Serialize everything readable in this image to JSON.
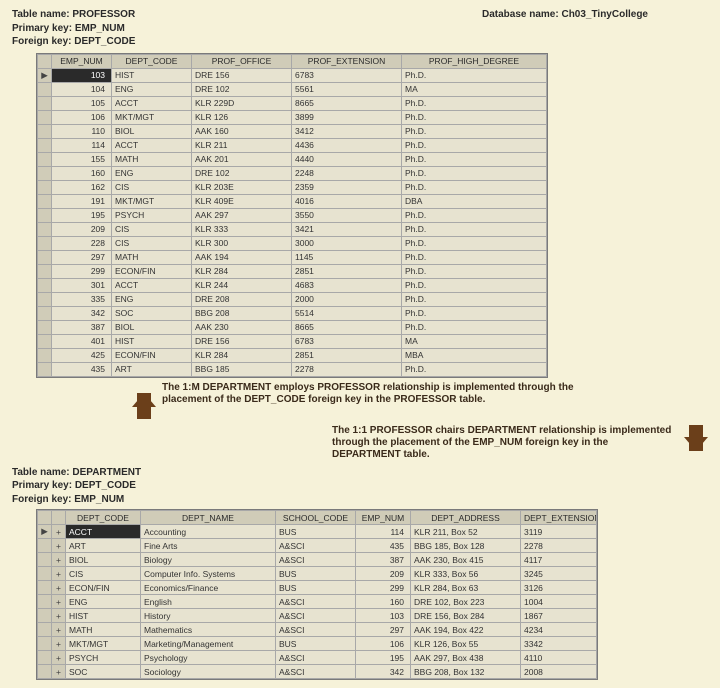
{
  "meta": {
    "table1_name_label": "Table name: PROFESSOR",
    "table1_pk_label": "Primary key: EMP_NUM",
    "table1_fk_label": "Foreign key: DEPT_CODE",
    "db_name_label": "Database name: Ch03_TinyCollege",
    "table2_name_label": "Table name: DEPARTMENT",
    "table2_pk_label": "Primary key: DEPT_CODE",
    "table2_fk_label": "Foreign key: EMP_NUM"
  },
  "prof_cols": [
    "EMP_NUM",
    "DEPT_CODE",
    "PROF_OFFICE",
    "PROF_EXTENSION",
    "PROF_HIGH_DEGREE"
  ],
  "prof_rows": [
    {
      "emp": "103",
      "dept": "HIST",
      "office": "DRE 156",
      "ext": "6783",
      "deg": "Ph.D.",
      "sel": true,
      "marker": "▶"
    },
    {
      "emp": "104",
      "dept": "ENG",
      "office": "DRE 102",
      "ext": "5561",
      "deg": "MA"
    },
    {
      "emp": "105",
      "dept": "ACCT",
      "office": "KLR 229D",
      "ext": "8665",
      "deg": "Ph.D."
    },
    {
      "emp": "106",
      "dept": "MKT/MGT",
      "office": "KLR 126",
      "ext": "3899",
      "deg": "Ph.D."
    },
    {
      "emp": "110",
      "dept": "BIOL",
      "office": "AAK 160",
      "ext": "3412",
      "deg": "Ph.D."
    },
    {
      "emp": "114",
      "dept": "ACCT",
      "office": "KLR 211",
      "ext": "4436",
      "deg": "Ph.D."
    },
    {
      "emp": "155",
      "dept": "MATH",
      "office": "AAK 201",
      "ext": "4440",
      "deg": "Ph.D."
    },
    {
      "emp": "160",
      "dept": "ENG",
      "office": "DRE 102",
      "ext": "2248",
      "deg": "Ph.D."
    },
    {
      "emp": "162",
      "dept": "CIS",
      "office": "KLR 203E",
      "ext": "2359",
      "deg": "Ph.D."
    },
    {
      "emp": "191",
      "dept": "MKT/MGT",
      "office": "KLR 409E",
      "ext": "4016",
      "deg": "DBA"
    },
    {
      "emp": "195",
      "dept": "PSYCH",
      "office": "AAK 297",
      "ext": "3550",
      "deg": "Ph.D."
    },
    {
      "emp": "209",
      "dept": "CIS",
      "office": "KLR 333",
      "ext": "3421",
      "deg": "Ph.D."
    },
    {
      "emp": "228",
      "dept": "CIS",
      "office": "KLR 300",
      "ext": "3000",
      "deg": "Ph.D."
    },
    {
      "emp": "297",
      "dept": "MATH",
      "office": "AAK 194",
      "ext": "1145",
      "deg": "Ph.D."
    },
    {
      "emp": "299",
      "dept": "ECON/FIN",
      "office": "KLR 284",
      "ext": "2851",
      "deg": "Ph.D."
    },
    {
      "emp": "301",
      "dept": "ACCT",
      "office": "KLR 244",
      "ext": "4683",
      "deg": "Ph.D."
    },
    {
      "emp": "335",
      "dept": "ENG",
      "office": "DRE 208",
      "ext": "2000",
      "deg": "Ph.D."
    },
    {
      "emp": "342",
      "dept": "SOC",
      "office": "BBG 208",
      "ext": "5514",
      "deg": "Ph.D."
    },
    {
      "emp": "387",
      "dept": "BIOL",
      "office": "AAK 230",
      "ext": "8665",
      "deg": "Ph.D."
    },
    {
      "emp": "401",
      "dept": "HIST",
      "office": "DRE 156",
      "ext": "6783",
      "deg": "MA"
    },
    {
      "emp": "425",
      "dept": "ECON/FIN",
      "office": "KLR 284",
      "ext": "2851",
      "deg": "MBA"
    },
    {
      "emp": "435",
      "dept": "ART",
      "office": "BBG 185",
      "ext": "2278",
      "deg": "Ph.D."
    }
  ],
  "dept_cols": [
    "DEPT_CODE",
    "DEPT_NAME",
    "SCHOOL_CODE",
    "EMP_NUM",
    "DEPT_ADDRESS",
    "DEPT_EXTENSION"
  ],
  "dept_rows": [
    {
      "marker": "▶",
      "code": "ACCT",
      "name": "Accounting",
      "school": "BUS",
      "emp": "114",
      "addr": "KLR 211, Box 52",
      "ext": "3119",
      "sel": true
    },
    {
      "marker": "+",
      "code": "ART",
      "name": "Fine Arts",
      "school": "A&SCI",
      "emp": "435",
      "addr": "BBG 185, Box 128",
      "ext": "2278"
    },
    {
      "marker": "+",
      "code": "BIOL",
      "name": "Biology",
      "school": "A&SCI",
      "emp": "387",
      "addr": "AAK 230, Box 415",
      "ext": "4117"
    },
    {
      "marker": "+",
      "code": "CIS",
      "name": "Computer Info. Systems",
      "school": "BUS",
      "emp": "209",
      "addr": "KLR 333, Box 56",
      "ext": "3245"
    },
    {
      "marker": "+",
      "code": "ECON/FIN",
      "name": "Economics/Finance",
      "school": "BUS",
      "emp": "299",
      "addr": "KLR 284, Box 63",
      "ext": "3126"
    },
    {
      "marker": "+",
      "code": "ENG",
      "name": "English",
      "school": "A&SCI",
      "emp": "160",
      "addr": "DRE 102, Box 223",
      "ext": "1004"
    },
    {
      "marker": "+",
      "code": "HIST",
      "name": "History",
      "school": "A&SCI",
      "emp": "103",
      "addr": "DRE 156, Box 284",
      "ext": "1867"
    },
    {
      "marker": "+",
      "code": "MATH",
      "name": "Mathematics",
      "school": "A&SCI",
      "emp": "297",
      "addr": "AAK 194, Box 422",
      "ext": "4234"
    },
    {
      "marker": "+",
      "code": "MKT/MGT",
      "name": "Marketing/Management",
      "school": "BUS",
      "emp": "106",
      "addr": "KLR 126, Box 55",
      "ext": "3342"
    },
    {
      "marker": "+",
      "code": "PSYCH",
      "name": "Psychology",
      "school": "A&SCI",
      "emp": "195",
      "addr": "AAK 297, Box 438",
      "ext": "4110"
    },
    {
      "marker": "+",
      "code": "SOC",
      "name": "Sociology",
      "school": "A&SCI",
      "emp": "342",
      "addr": "BBG 208, Box 132",
      "ext": "2008"
    }
  ],
  "annot1": "The 1:M DEPARTMENT employs PROFESSOR relationship is implemented through the placement of the DEPT_CODE foreign key in the PROFESSOR table.",
  "annot2": "The 1:1 PROFESSOR chairs DEPARTMENT relationship is implemented through the placement of the EMP_NUM foreign key in the DEPARTMENT table."
}
